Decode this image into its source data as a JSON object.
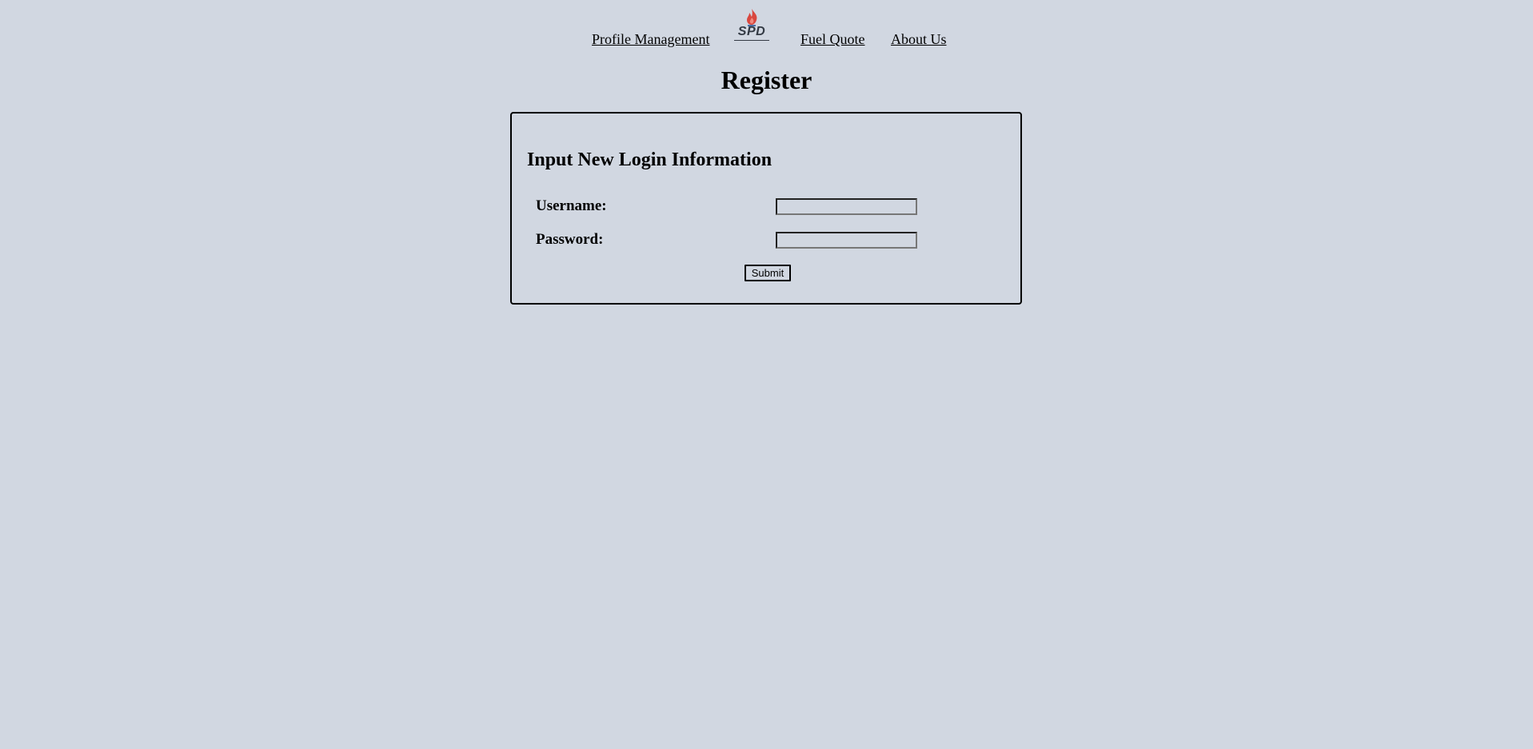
{
  "nav": {
    "profile_label": "Profile Management",
    "fuel_label": "Fuel Quote",
    "about_label": "About Us",
    "logo_text": "SPD"
  },
  "page": {
    "title": "Register"
  },
  "form": {
    "heading": "Input New Login Information",
    "username_label": "Username:",
    "username_value": "",
    "password_label": "Password:",
    "password_value": "",
    "submit_label": "Submit"
  },
  "colors": {
    "background": "#d1d7e1",
    "logo_flame_red": "#d9473f",
    "logo_flame_blue": "#4a6fa5",
    "logo_text": "#333a44"
  },
  "icons": {
    "logo": "flame-icon"
  }
}
